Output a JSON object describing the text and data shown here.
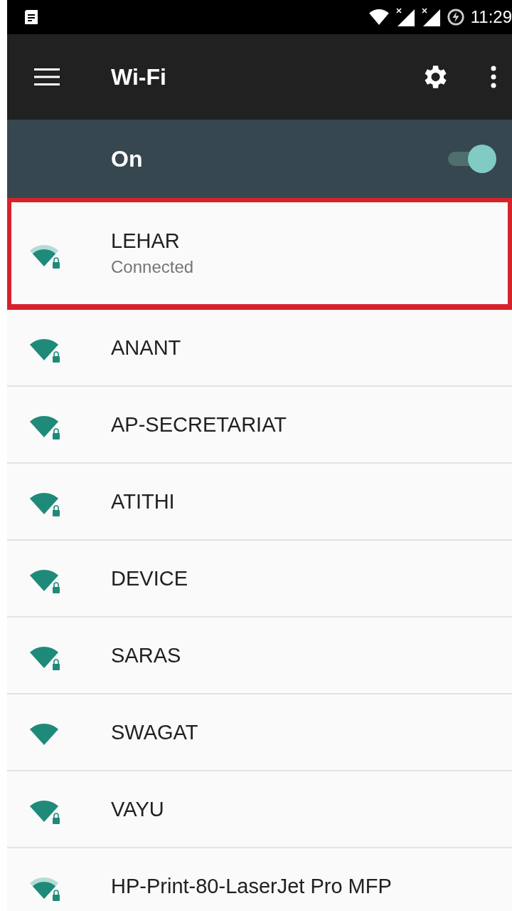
{
  "status_bar": {
    "time": "11:29"
  },
  "toolbar": {
    "title": "Wi-Fi"
  },
  "master_switch": {
    "label": "On",
    "on": true
  },
  "networks": [
    {
      "name": "LEHAR",
      "status": "Connected",
      "weak_signal": true,
      "secured": true,
      "highlighted": true
    },
    {
      "name": "ANANT",
      "weak_signal": false,
      "secured": true,
      "highlighted": false
    },
    {
      "name": "AP-SECRETARIAT",
      "weak_signal": false,
      "secured": true,
      "highlighted": false
    },
    {
      "name": "ATITHI",
      "weak_signal": false,
      "secured": true,
      "highlighted": false
    },
    {
      "name": "DEVICE",
      "weak_signal": false,
      "secured": true,
      "highlighted": false
    },
    {
      "name": "SARAS",
      "weak_signal": false,
      "secured": true,
      "highlighted": false
    },
    {
      "name": "SWAGAT",
      "weak_signal": false,
      "secured": false,
      "highlighted": false
    },
    {
      "name": "VAYU",
      "weak_signal": false,
      "secured": true,
      "highlighted": false
    },
    {
      "name": "HP-Print-80-LaserJet Pro MFP",
      "weak_signal": true,
      "secured": true,
      "highlighted": false
    }
  ]
}
